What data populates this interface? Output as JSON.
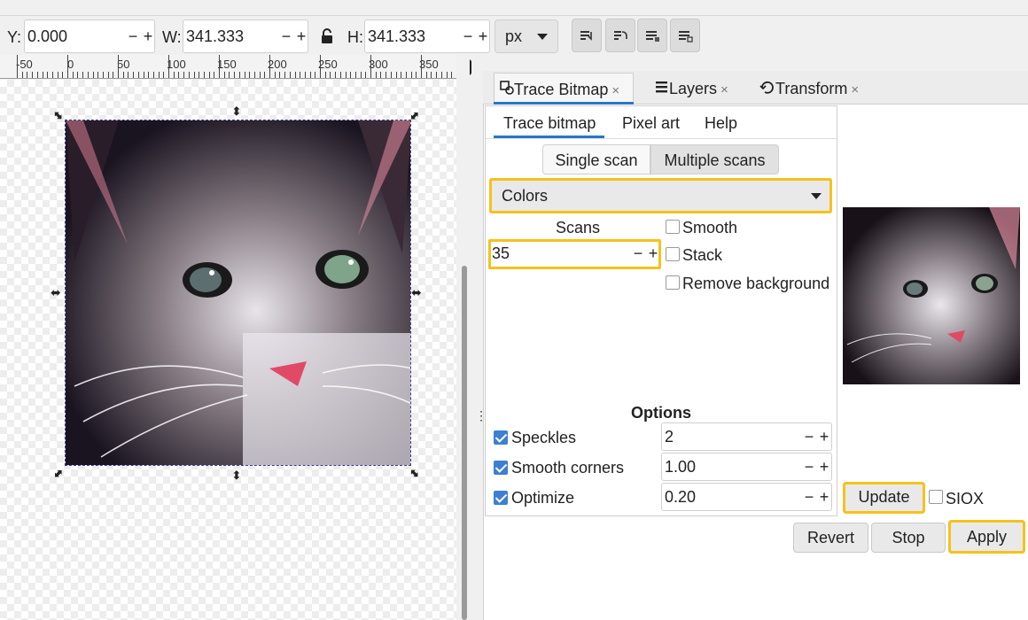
{
  "toolbar": {
    "y_label": "Y:",
    "y_value": "0.000",
    "w_label": "W:",
    "w_value": "341.333",
    "h_label": "H:",
    "h_value": "341.333",
    "unit": "px",
    "minus": "−",
    "plus": "+"
  },
  "ruler": {
    "ticks": [
      "-50",
      "0",
      "50",
      "100",
      "150",
      "200",
      "250",
      "300",
      "350"
    ],
    "badge": "1"
  },
  "dock": {
    "tabs": [
      {
        "label": "Trace Bitmap",
        "icon": "trace-bitmap-icon"
      },
      {
        "label": "Layers",
        "icon": "layers-icon"
      },
      {
        "label": "Transform",
        "icon": "transform-icon"
      }
    ],
    "close_glyph": "×"
  },
  "trace": {
    "subtabs": [
      "Trace bitmap",
      "Pixel art",
      "Help"
    ],
    "scan_modes": [
      "Single scan",
      "Multiple scans"
    ],
    "mode_select": "Colors",
    "scans_label": "Scans",
    "scans_value": "35",
    "checks": {
      "smooth": "Smooth",
      "stack": "Stack",
      "remove_background": "Remove background"
    },
    "options_title": "Options",
    "options": [
      {
        "label": "Speckles",
        "value": "2",
        "checked": true
      },
      {
        "label": "Smooth corners",
        "value": "1.00",
        "checked": true
      },
      {
        "label": "Optimize",
        "value": "0.20",
        "checked": true
      }
    ],
    "update": "Update",
    "siox": "SIOX",
    "revert": "Revert",
    "stop": "Stop",
    "apply": "Apply"
  },
  "colors": {
    "highlight": "#f4c21d",
    "accent": "#2a76c6",
    "checkbox": "#3d7fd1"
  }
}
